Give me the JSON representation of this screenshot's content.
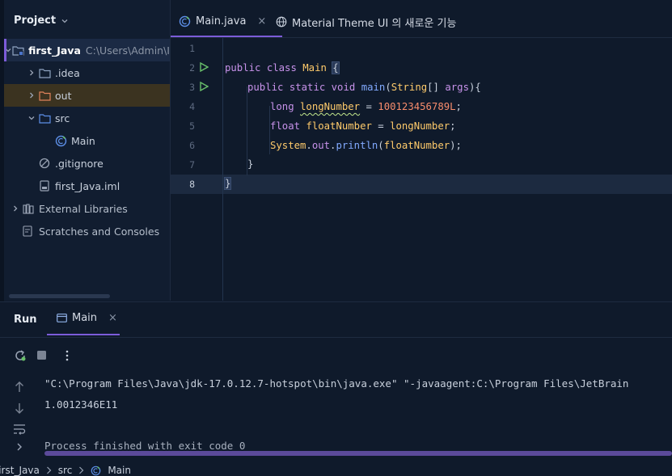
{
  "project_panel": {
    "title": "Project",
    "tree": [
      {
        "label": "first_Java",
        "path": "C:\\Users\\Admin\\I",
        "icon": "module-folder-icon",
        "depth": 0,
        "expanded": true
      },
      {
        "label": ".idea",
        "icon": "folder-icon",
        "depth": 1,
        "expanded": false
      },
      {
        "label": "out",
        "icon": "folder-excluded-icon",
        "depth": 1,
        "expanded": false
      },
      {
        "label": "src",
        "icon": "folder-source-icon",
        "depth": 1,
        "expanded": true
      },
      {
        "label": "Main",
        "icon": "java-class-icon",
        "depth": 2
      },
      {
        "label": ".gitignore",
        "icon": "ignore-file-icon",
        "depth": 1
      },
      {
        "label": "first_Java.iml",
        "icon": "iml-file-icon",
        "depth": 1
      },
      {
        "label": "External Libraries",
        "icon": "library-icon",
        "depth": 0,
        "expanded": false
      },
      {
        "label": "Scratches and Consoles",
        "icon": "scratches-icon",
        "depth": 0
      }
    ]
  },
  "editor_tabs": [
    {
      "label": "Main.java",
      "icon": "java-class-icon",
      "active": true,
      "close": "×"
    },
    {
      "label": "Material Theme UI 의 새로운 기능",
      "icon": "globe-icon",
      "active": false
    }
  ],
  "editor": {
    "line_numbers": [
      "1",
      "2",
      "3",
      "4",
      "5",
      "6",
      "7",
      "8"
    ],
    "current_line": "8",
    "code": {
      "l2_kw1": "public",
      "l2_kw2": "class",
      "l2_cls": "Main",
      "l2_brace": "{",
      "l3_kw1": "public",
      "l3_kw2": "static",
      "l3_kw3": "void",
      "l3_fn": "main",
      "l3_p1": "(",
      "l3_type": "String",
      "l3_p2": "[] ",
      "l3_arg": "args",
      "l3_p3": "){",
      "l4_kw": "long",
      "l4_var": "longNumber",
      "l4_op": " = ",
      "l4_num": "100123456789L",
      "l4_end": ";",
      "l5_kw": "float",
      "l5_var": "floatNumber",
      "l5_op": " = ",
      "l5_ref": "longNumber",
      "l5_end": ";",
      "l6_cls": "System",
      "l6_dot1": ".",
      "l6_out": "out",
      "l6_dot2": ".",
      "l6_fn": "println",
      "l6_p1": "(",
      "l6_arg": "floatNumber",
      "l6_p2": ");",
      "l7": "}",
      "l8": "}"
    }
  },
  "run_panel": {
    "title": "Run",
    "tab_label": "Main",
    "tab_close": "×",
    "console_lines": [
      "\"C:\\Program Files\\Java\\jdk-17.0.12.7-hotspot\\bin\\java.exe\" \"-javaagent:C:\\Program Files\\JetBrain",
      "1.0012346E11",
      "",
      "Process finished with exit code 0"
    ]
  },
  "breadcrumb": [
    "first_Java",
    "src",
    "Main"
  ],
  "colors": {
    "accent": "#7c5cd9",
    "background": "#0f1a2b",
    "keyword": "#c792ea",
    "class": "#ffcb6b",
    "number": "#f78c6c",
    "string": "#c3e88d",
    "function": "#82aaff"
  }
}
